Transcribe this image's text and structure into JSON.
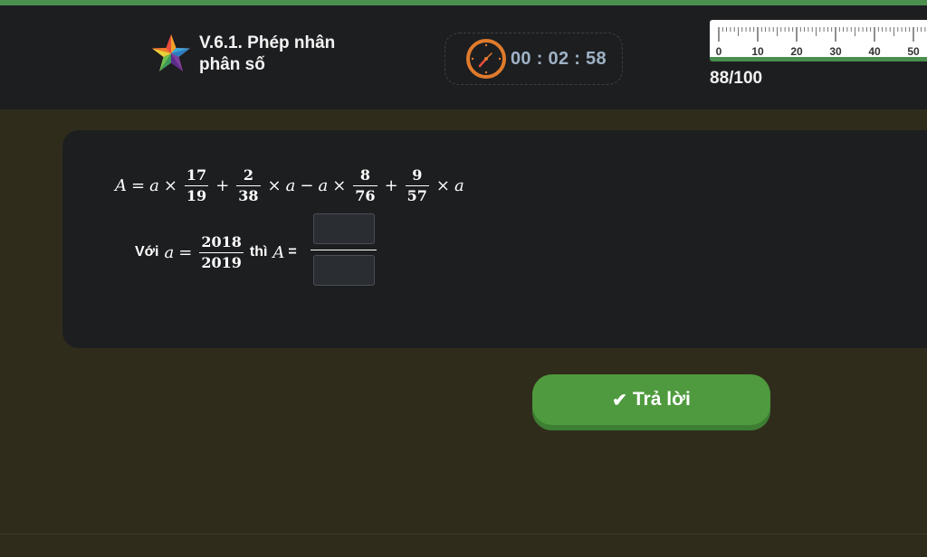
{
  "header": {
    "lesson_title": "V.6.1. Phép nhân phân số",
    "timer": "00 : 02 : 58",
    "score": "88/100",
    "ruler_labels": [
      "0",
      "10",
      "20",
      "30",
      "40",
      "50"
    ],
    "icons": {
      "lesson": "star-icon",
      "timer": "clock-icon"
    }
  },
  "problem": {
    "var_A": "A",
    "var_a": "a",
    "equals": "=",
    "times": "×",
    "plus": "+",
    "minus": "−",
    "fractions": [
      {
        "num": "17",
        "den": "19"
      },
      {
        "num": "2",
        "den": "38"
      },
      {
        "num": "8",
        "den": "76"
      },
      {
        "num": "9",
        "den": "57"
      }
    ],
    "given_prefix": "Với",
    "given_fraction": {
      "num": "2018",
      "den": "2019"
    },
    "then_text": "thì",
    "answer_equals": "=",
    "answer_numerator": "",
    "answer_denominator": ""
  },
  "submit": {
    "label": "Trả lời",
    "icon": "check-icon"
  },
  "colors": {
    "accent_green": "#4f9a3e",
    "header_bg": "#1d1e20",
    "page_bg": "#2f2c1c",
    "timer_text": "#9fb2c6",
    "clock_orange": "#e07b2c"
  }
}
